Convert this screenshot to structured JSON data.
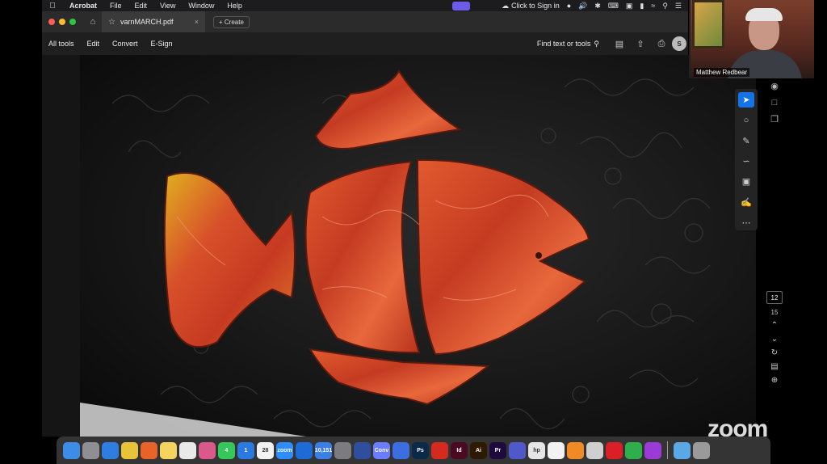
{
  "menubar": {
    "app_name": "Acrobat",
    "menus": [
      "File",
      "Edit",
      "View",
      "Window",
      "Help"
    ],
    "sign_in": "Click to Sign in"
  },
  "tabs": {
    "document_title": "varnMARCH.pdf",
    "close": "×",
    "create_label": "Create"
  },
  "toolbar": {
    "tools": [
      "All tools",
      "Edit",
      "Convert",
      "E-Sign"
    ],
    "find_label": "Find text or tools",
    "share_label": "S"
  },
  "page_nav": {
    "current_page": "12",
    "total_pages": "15"
  },
  "video": {
    "participant_name": "Matthew Redbear"
  },
  "watermark": "zoom",
  "dock": {
    "apps": [
      {
        "name": "finder",
        "color": "#3d8de8",
        "label": ""
      },
      {
        "name": "launchpad",
        "color": "#8e8e93",
        "label": ""
      },
      {
        "name": "safari",
        "color": "#2f7de1",
        "label": ""
      },
      {
        "name": "chrome",
        "color": "#e8c33a",
        "label": ""
      },
      {
        "name": "firefox",
        "color": "#e8632a",
        "label": ""
      },
      {
        "name": "notes",
        "color": "#f4d35e",
        "label": ""
      },
      {
        "name": "freeform",
        "color": "#e9e9e9",
        "label": ""
      },
      {
        "name": "photos",
        "color": "#d95a8a",
        "label": ""
      },
      {
        "name": "messages",
        "color": "#34c759",
        "label": "4"
      },
      {
        "name": "mail",
        "color": "#2a7ae2",
        "label": "1"
      },
      {
        "name": "calendar",
        "color": "#f2f2f2",
        "label": "28"
      },
      {
        "name": "zoom",
        "color": "#2d8cff",
        "label": "zoom"
      },
      {
        "name": "ladder",
        "color": "#1e6ad6",
        "label": ""
      },
      {
        "name": "mail-spark",
        "color": "#3b7fe6",
        "label": "10,151"
      },
      {
        "name": "system-settings",
        "color": "#7b7b80",
        "label": ""
      },
      {
        "name": "preview",
        "color": "#2f4f9e",
        "label": ""
      },
      {
        "name": "conv",
        "color": "#6a7cff",
        "label": "Conv"
      },
      {
        "name": "grid-app",
        "color": "#3c6ee0",
        "label": ""
      },
      {
        "name": "photoshop",
        "color": "#0b2a4a",
        "label": "Ps"
      },
      {
        "name": "acrobat",
        "color": "#d42a1f",
        "label": ""
      },
      {
        "name": "indesign",
        "color": "#4a0a22",
        "label": "Id"
      },
      {
        "name": "illustrator",
        "color": "#2e1a00",
        "label": "Ai"
      },
      {
        "name": "premiere",
        "color": "#1e0a3c",
        "label": "Pr"
      },
      {
        "name": "teams",
        "color": "#5059c9",
        "label": ""
      },
      {
        "name": "hp",
        "color": "#e6e6e6",
        "label": "hp"
      },
      {
        "name": "slack",
        "color": "#f2f2f2",
        "label": ""
      },
      {
        "name": "books",
        "color": "#f08a24",
        "label": ""
      },
      {
        "name": "word-app",
        "color": "#cfcfcf",
        "label": ""
      },
      {
        "name": "creative-cloud",
        "color": "#da1f26",
        "label": ""
      },
      {
        "name": "numbers",
        "color": "#2fae4c",
        "label": ""
      },
      {
        "name": "podcasts",
        "color": "#9b3ad6",
        "label": ""
      },
      {
        "name": "folder",
        "color": "#5aa9e6",
        "label": ""
      },
      {
        "name": "trash",
        "color": "#9a9a9a",
        "label": ""
      }
    ]
  }
}
